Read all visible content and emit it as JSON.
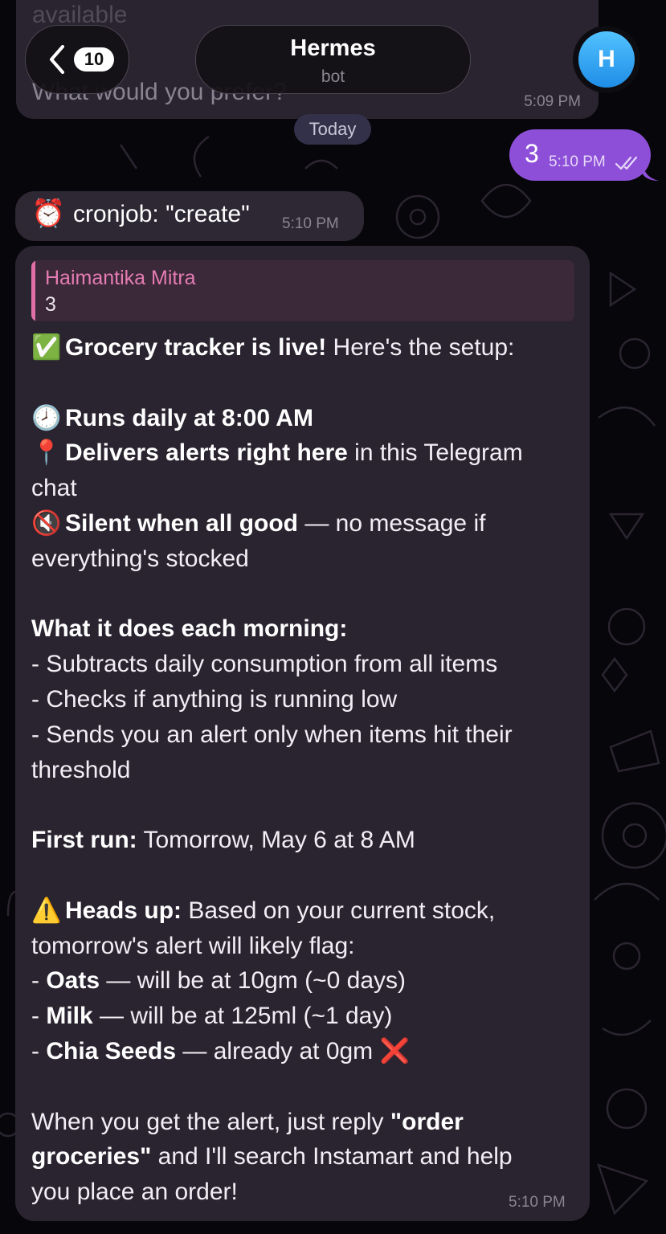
{
  "nav": {
    "back_count": "10",
    "title": "Hermes",
    "subtitle": "bot",
    "avatar_letter": "H"
  },
  "previous_message": {
    "cut_text_top": "available",
    "cut_text": "What would you prefer?",
    "time": "5:09 PM"
  },
  "date_separator": "Today",
  "outgoing": {
    "text": "3",
    "time": "5:10 PM",
    "status_icon": "double-check-icon"
  },
  "cron_message": {
    "emoji": "⏰",
    "text": "cronjob: \"create\"",
    "time": "5:10 PM"
  },
  "main_message": {
    "reply": {
      "name": "Haimantika Mitra",
      "text": "3"
    },
    "time": "5:10 PM",
    "lines": {
      "l1_emoji": "✅",
      "l1_bold": "Grocery tracker is live!",
      "l1_rest": " Here's the setup:",
      "l2_emoji": "🕗",
      "l2_bold": "Runs daily at 8:00 AM",
      "l3_emoji": "📍",
      "l3_bold": "Delivers alerts right here",
      "l3_rest": " in this Telegram",
      "l3b": "chat",
      "l4_emoji": "🔇",
      "l4_bold": "Silent when all good",
      "l4_rest": " — no message if",
      "l4b": "everything's stocked",
      "l5_bold": "What it does each morning:",
      "l6": "- Subtracts daily consumption from all items",
      "l7": "- Checks if anything is running low",
      "l8": "- Sends you an alert only when items hit their",
      "l8b": "threshold",
      "l9_bold": "First run:",
      "l9_rest": " Tomorrow, May 6 at 8 AM",
      "l10_emoji": "⚠️",
      "l10_bold": "Heads up:",
      "l10_rest": " Based on your current stock,",
      "l11": "tomorrow's alert will likely flag:",
      "l12_pre": "- ",
      "l12_bold": "Oats",
      "l12_rest": " — will be at 10gm (~0 days)",
      "l13_pre": "- ",
      "l13_bold": "Milk",
      "l13_rest": " — will be at 125ml (~1 day)",
      "l14_pre": "- ",
      "l14_bold": "Chia Seeds",
      "l14_rest": " — already at 0gm ",
      "l14_emoji": "❌",
      "l15_pre": "When you get the alert, just reply ",
      "l15_bold": "\"order",
      "l16_bold": "groceries\"",
      "l16_rest": " and I'll search Instamart and help",
      "l17": "you place an order!"
    }
  },
  "colors": {
    "background": "#07060a",
    "incoming_bubble": "#2a2430",
    "outgoing_bubble": "#8e4fd8",
    "reply_name": "#e57cb3",
    "avatar": "#2f9cf0"
  }
}
